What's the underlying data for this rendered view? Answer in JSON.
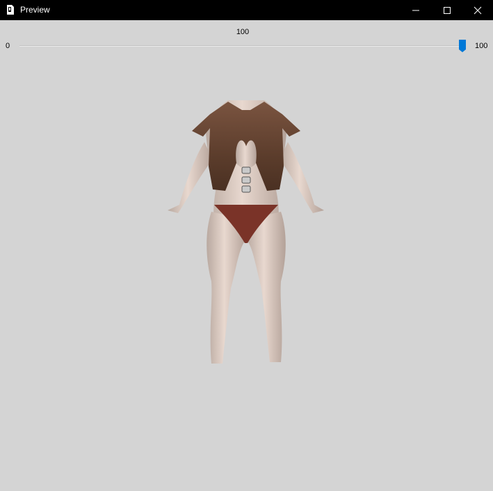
{
  "window": {
    "title": "Preview",
    "icon": "app-icon",
    "controls": {
      "minimize_icon": "minimize-icon",
      "maximize_icon": "maximize-icon",
      "close_icon": "close-icon"
    }
  },
  "slider": {
    "value": 100,
    "value_label": "100",
    "min_label": "0",
    "max_label": "100",
    "accent_color": "#0078d7"
  },
  "preview": {
    "background_color": "#d4d4d4",
    "content": "3D character model wearing brown leather vest and red briefs"
  }
}
